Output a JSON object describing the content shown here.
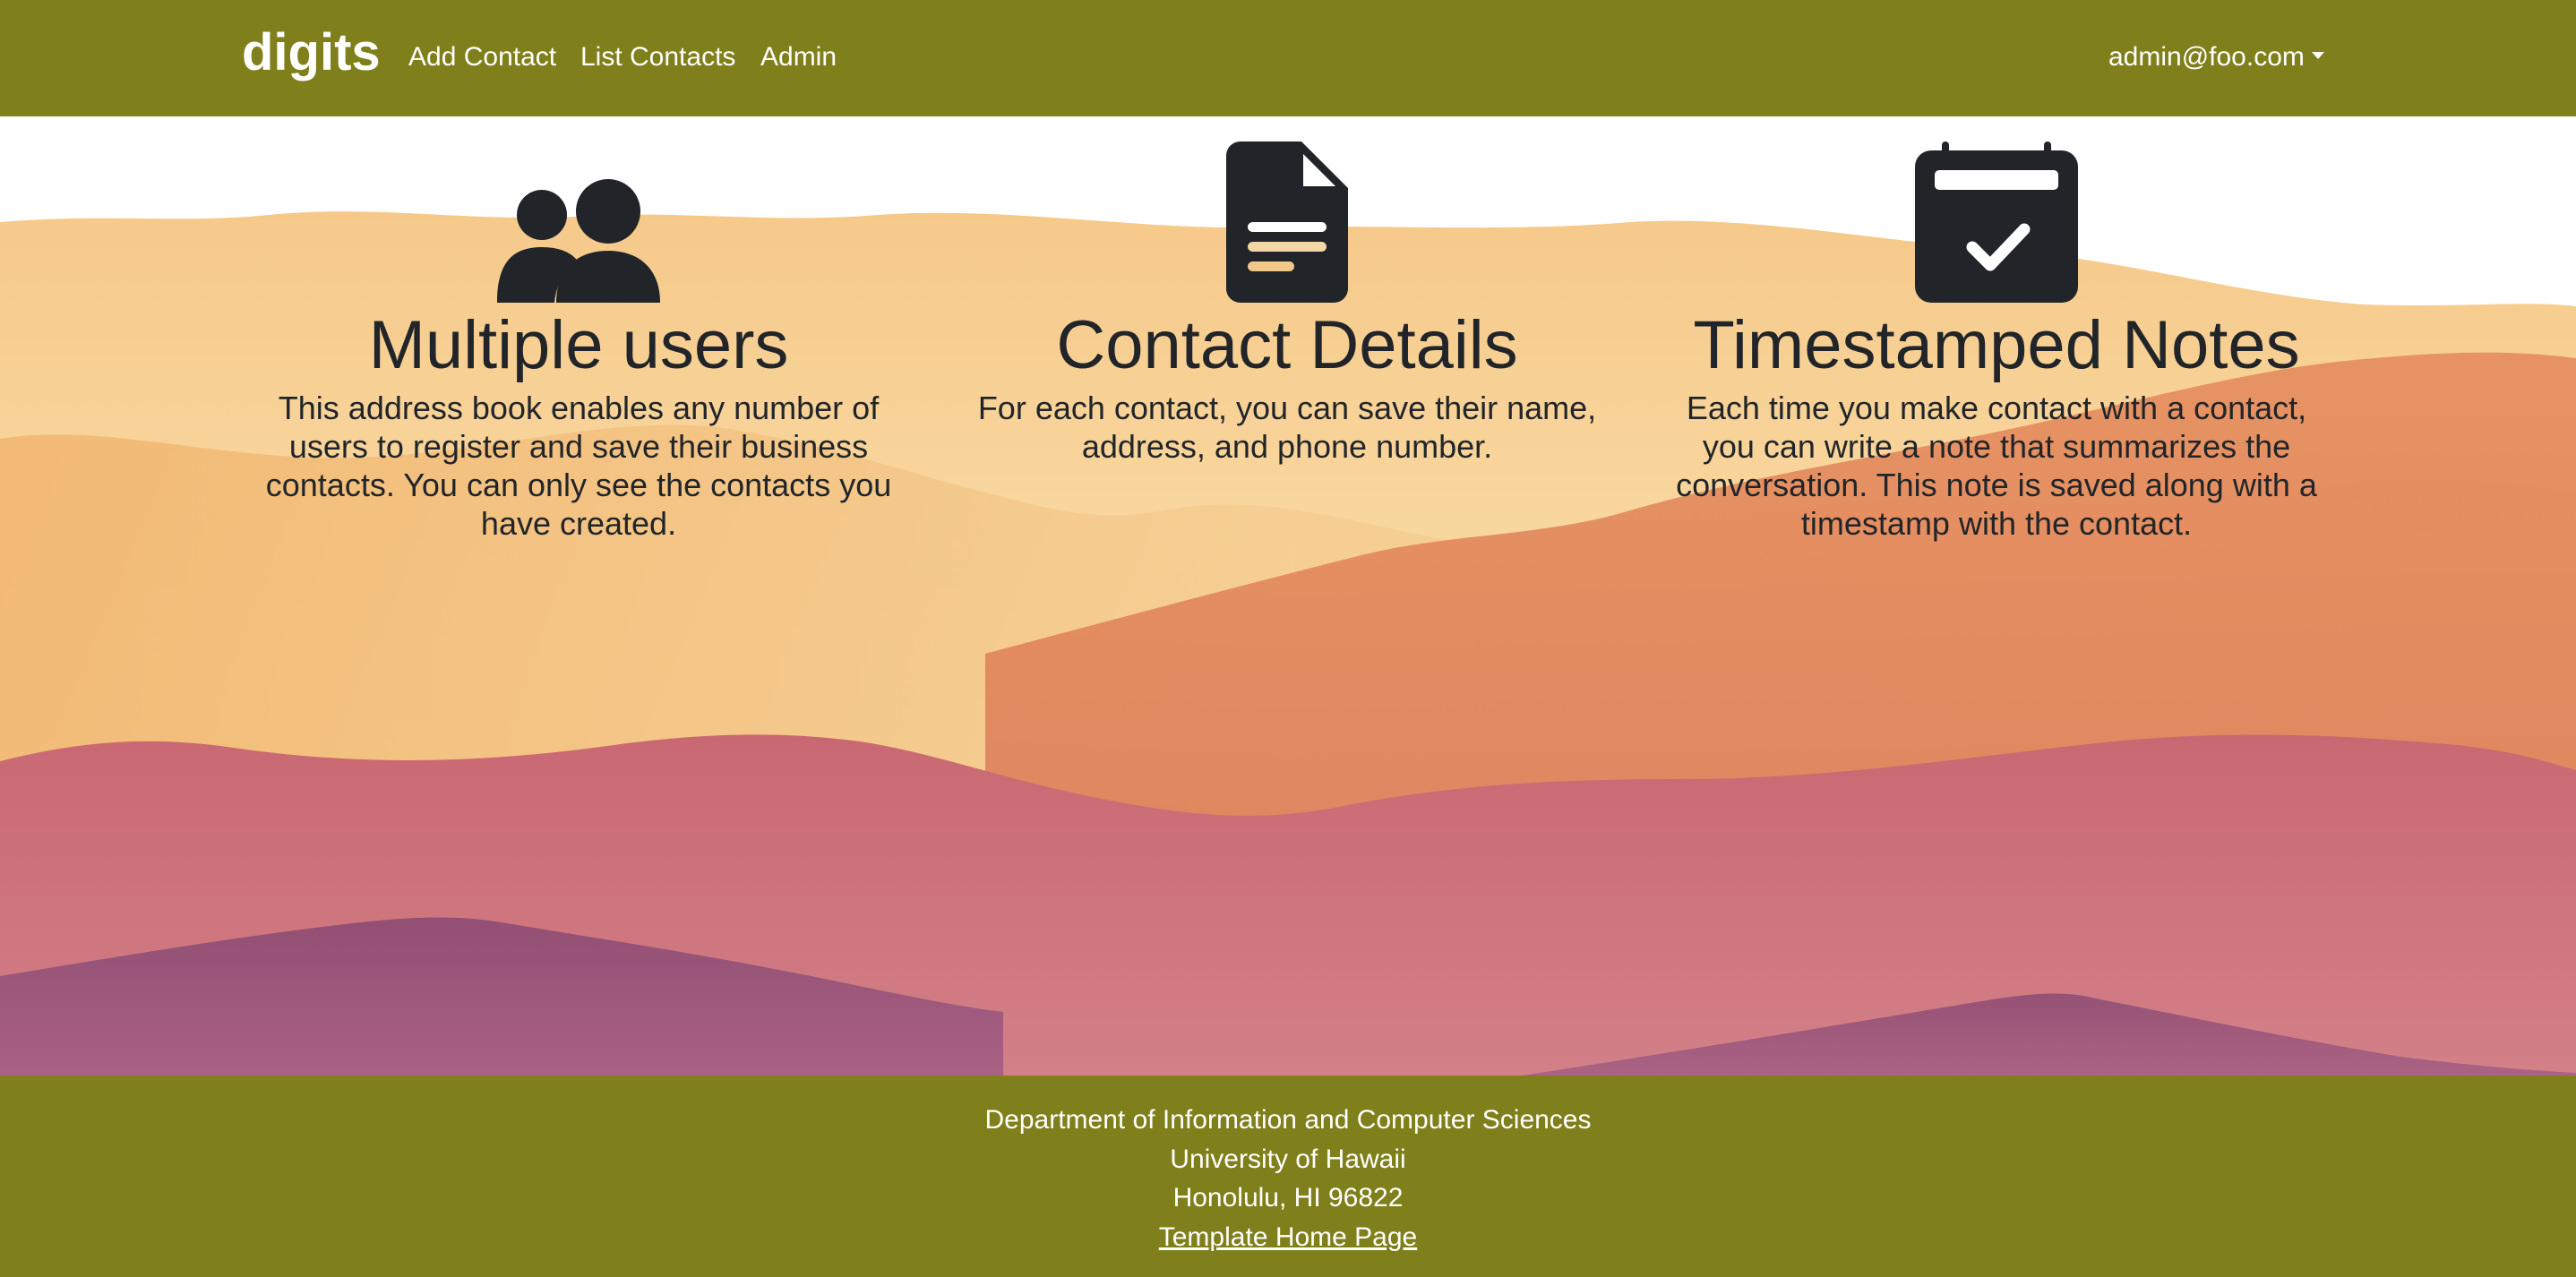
{
  "navbar": {
    "brand": "digits",
    "links": [
      {
        "label": "Add Contact"
      },
      {
        "label": "List Contacts"
      },
      {
        "label": "Admin"
      }
    ],
    "user_menu": "admin@foo.com",
    "background_color": "#7f7f1b"
  },
  "features": [
    {
      "icon": "people-icon",
      "title": "Multiple users",
      "description": "This address book enables any number of users to register and save their business contacts. You can only see the contacts you have created."
    },
    {
      "icon": "document-icon",
      "title": "Contact Details",
      "description": "For each contact, you can save their name, address, and phone number."
    },
    {
      "icon": "calendar-check-icon",
      "title": "Timestamped Notes",
      "description": "Each time you make contact with a contact, you can write a note that summarizes the conversation. This note is saved along with a timestamp with the contact."
    }
  ],
  "footer": {
    "line1": "Department of Information and Computer Sciences",
    "line2": "University of Hawaii",
    "line3": "Honolulu, HI 96822",
    "link": "Template Home Page"
  }
}
